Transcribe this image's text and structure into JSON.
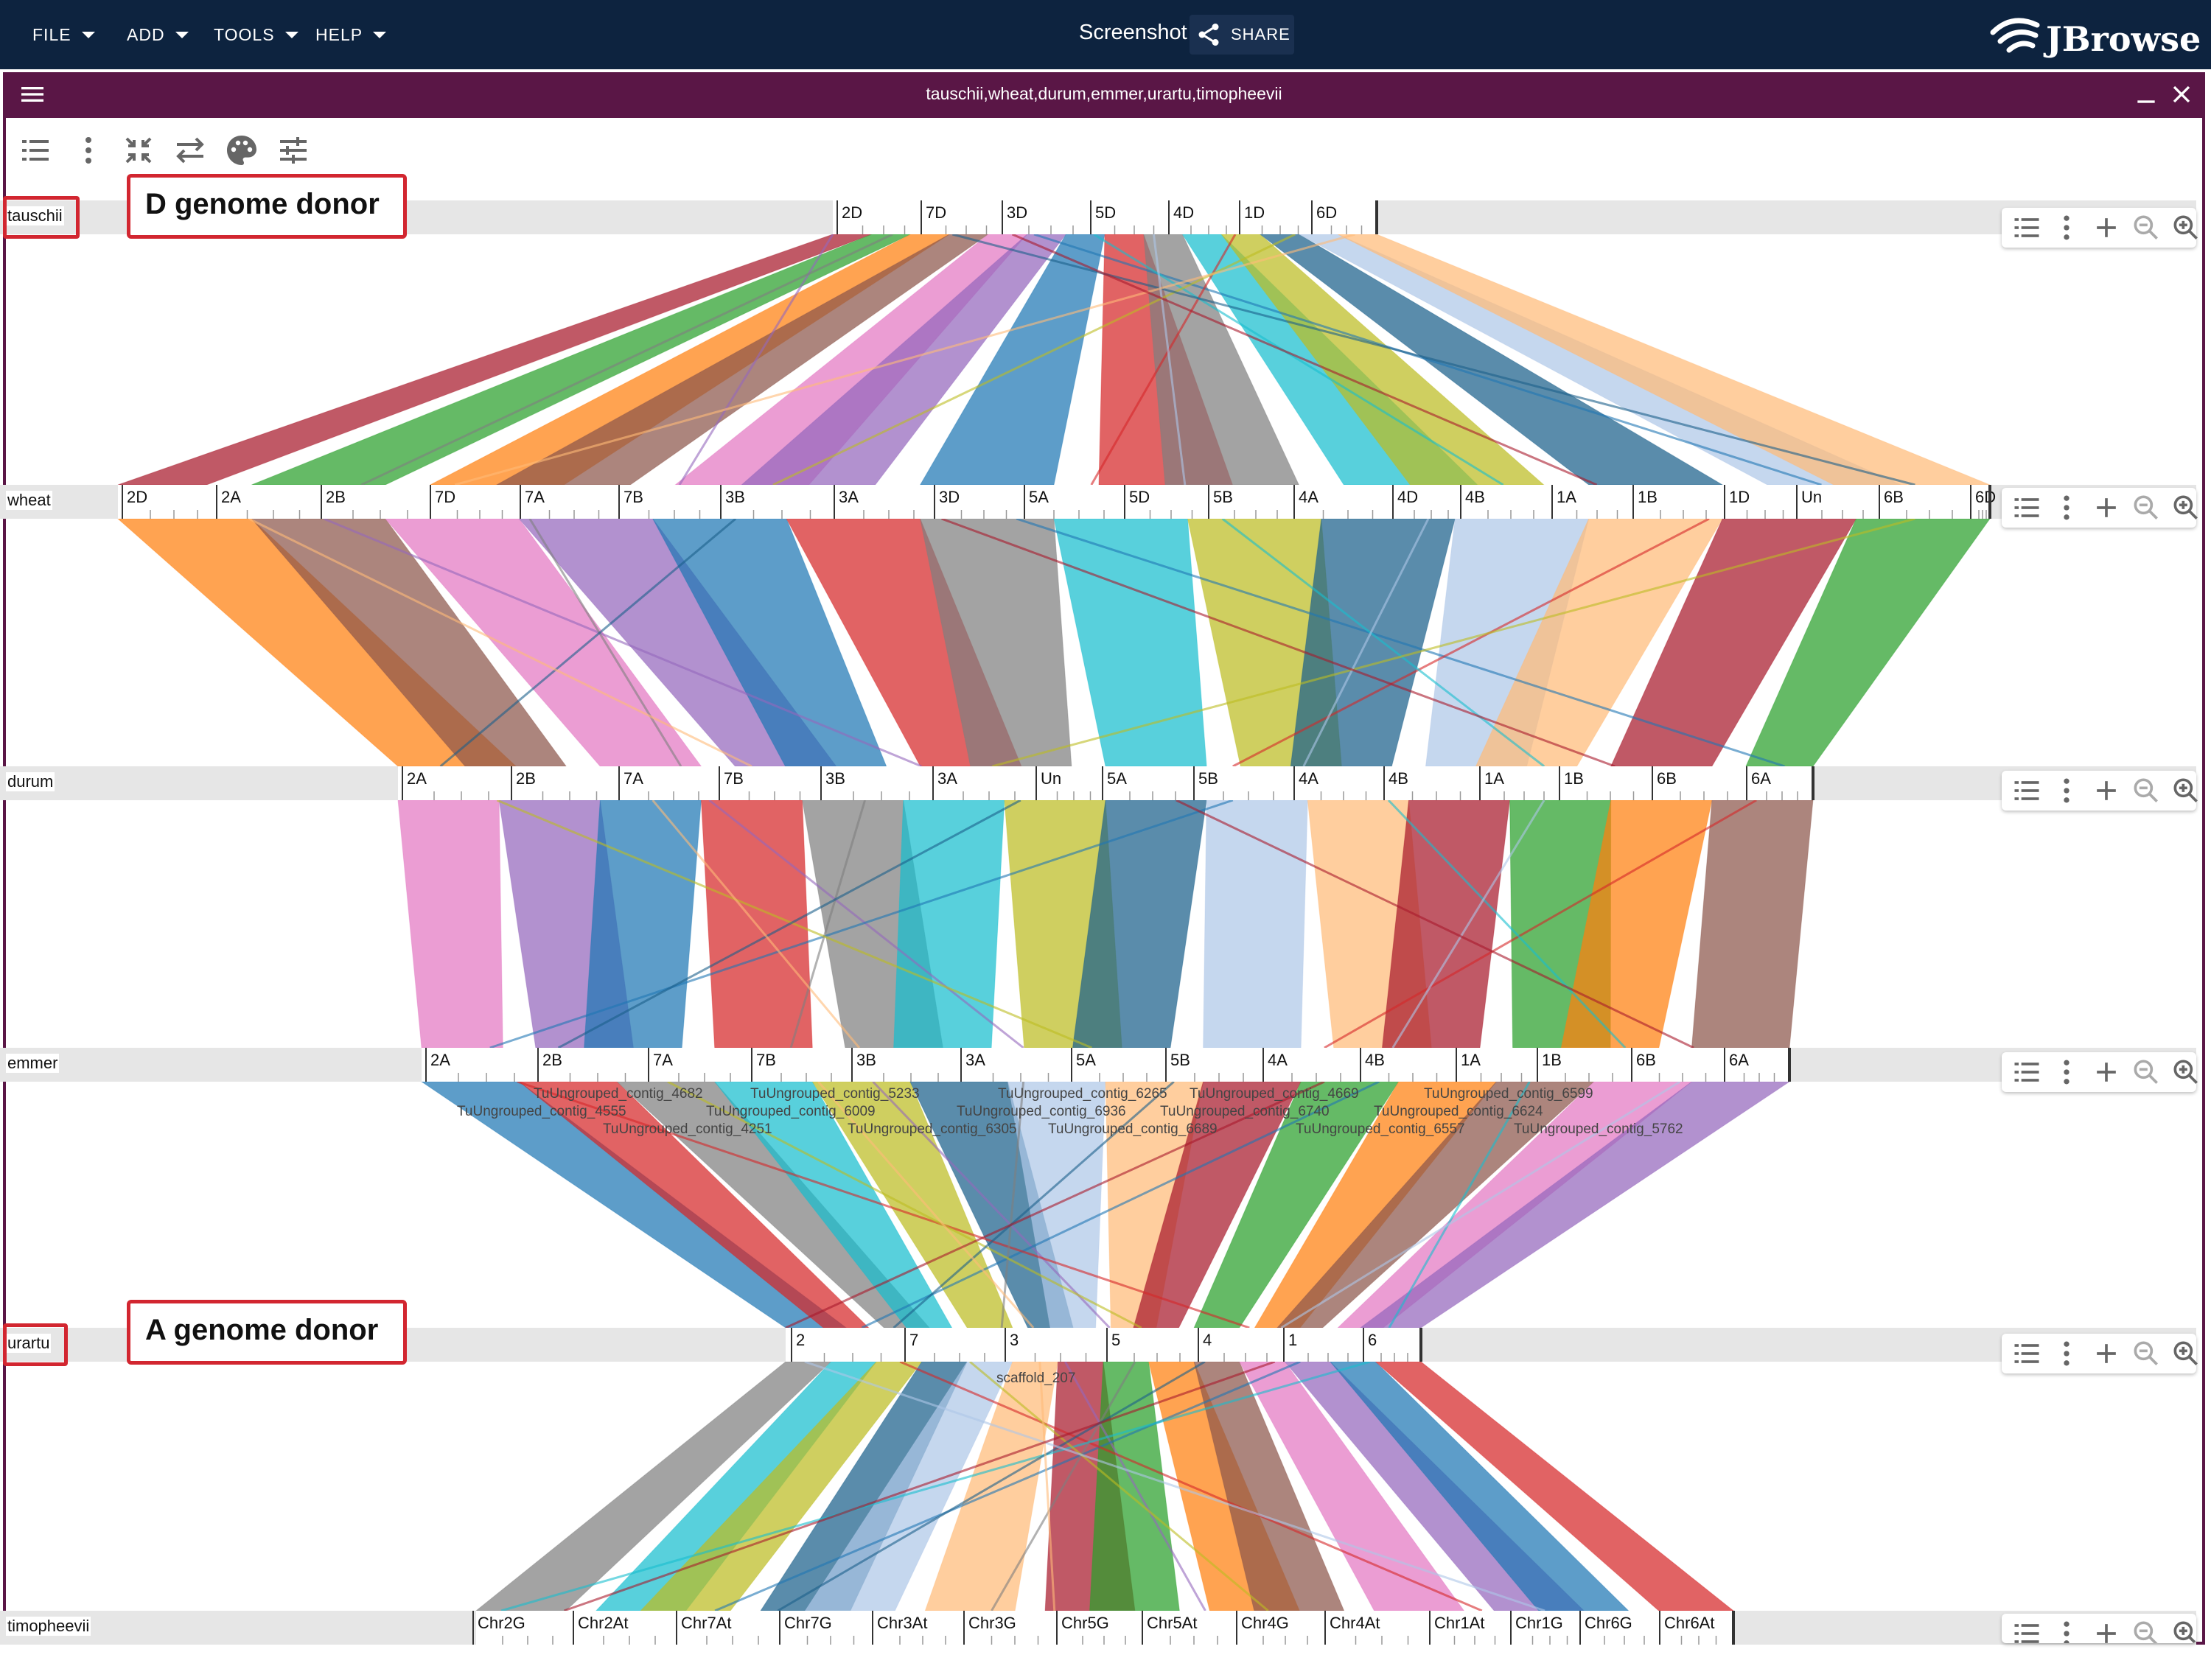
{
  "appbar": {
    "menus": [
      {
        "label": "FILE"
      },
      {
        "label": "ADD"
      },
      {
        "label": "TOOLS"
      },
      {
        "label": "HELP"
      }
    ],
    "screenshot_title": "Screenshot",
    "share_label": "SHARE",
    "logo_text": "JBrowse"
  },
  "view": {
    "title": "tauschii,wheat,durum,emmer,urartu,timopheevii",
    "toolbar_icons": [
      "track-list-icon",
      "kebab-menu-icon",
      "collapse-icon",
      "swap-icon",
      "palette-icon",
      "settings-sliders-icon"
    ],
    "track_control_icons": [
      "track-list-icon",
      "kebab-menu-icon",
      "zoom-plus-icon",
      "zoom-out-icon",
      "zoom-in-icon"
    ]
  },
  "annotations": [
    {
      "text": "D genome donor",
      "track": "tauschii"
    },
    {
      "text": "A genome donor",
      "track": "urartu"
    }
  ],
  "tracks": [
    {
      "name": "tauschii",
      "highlighted": true,
      "chromosomes": [
        "2D",
        "7D",
        "3D",
        "5D",
        "4D",
        "1D",
        "6D"
      ]
    },
    {
      "name": "wheat",
      "highlighted": false,
      "chromosomes": [
        "2D",
        "2A",
        "2B",
        "7D",
        "7A",
        "7B",
        "3B",
        "3A",
        "3D",
        "5A",
        "5D",
        "5B",
        "4A",
        "4D",
        "4B",
        "1A",
        "1B",
        "1D",
        "Un",
        "6B",
        "6D"
      ]
    },
    {
      "name": "durum",
      "highlighted": false,
      "chromosomes": [
        "2A",
        "2B",
        "7A",
        "7B",
        "3B",
        "3A",
        "Un",
        "5A",
        "5B",
        "4A",
        "4B",
        "1A",
        "1B",
        "6B",
        "6A"
      ]
    },
    {
      "name": "emmer",
      "highlighted": false,
      "chromosomes": [
        "2A",
        "2B",
        "7A",
        "7B",
        "3B",
        "3A",
        "5A",
        "5B",
        "4A",
        "4B",
        "1A",
        "1B",
        "6B",
        "6A"
      ],
      "feature_labels": [
        "TuUngrouped_contig_4682",
        "TuUngrouped_contig_5233",
        "TuUngrouped_contig_6265",
        "TuUngrouped_contig_4669",
        "TuUngrouped_contig_6599",
        "TuUngrouped_contig_4555",
        "TuUngrouped_contig_6009",
        "TuUngrouped_contig_6936",
        "TuUngrouped_contig_6740",
        "TuUngrouped_contig_6624",
        "TuUngrouped_contig_4251",
        "TuUngrouped_contig_6305",
        "TuUngrouped_contig_6689",
        "TuUngrouped_contig_6557",
        "TuUngrouped_contig_5762"
      ]
    },
    {
      "name": "urartu",
      "highlighted": true,
      "chromosomes": [
        "2",
        "7",
        "3",
        "5",
        "4",
        "1",
        "6"
      ],
      "feature_labels": [
        "scaffold_207"
      ]
    },
    {
      "name": "timopheevii",
      "highlighted": false,
      "chromosomes": [
        "Chr2G",
        "Chr2At",
        "Chr7At",
        "Chr7G",
        "Chr3At",
        "Chr3G",
        "Chr5G",
        "Chr5At",
        "Chr4G",
        "Chr4At",
        "Chr1At",
        "Chr1G",
        "Chr6G",
        "Chr6At"
      ]
    }
  ],
  "colors": {
    "appbar": "#0d233f",
    "view_header": "#5a1646",
    "annotation_border": "#d22630",
    "synteny_palette": [
      "#a8192b",
      "#2aa02b",
      "#ff7f0e",
      "#8c564b",
      "#e377c2",
      "#9467bd",
      "#1f77b4",
      "#d62728",
      "#7f7f7f",
      "#17becf",
      "#bcbd22",
      "#1a5f8a",
      "#aec7e8",
      "#ffbb78"
    ]
  }
}
